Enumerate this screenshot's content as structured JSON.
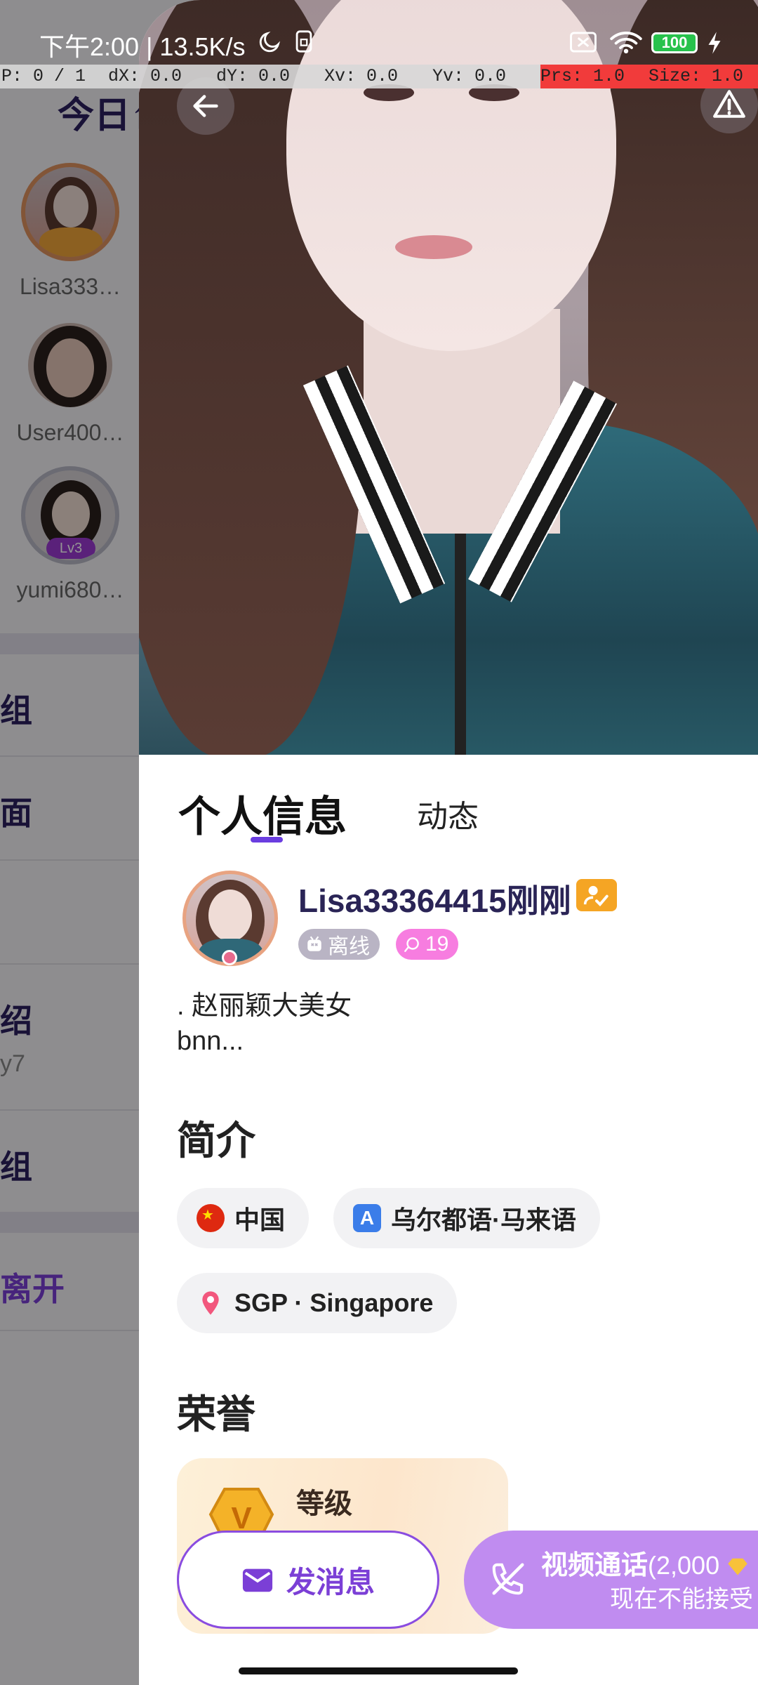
{
  "status_bar": {
    "text": "下午2:00 | 13.5K/s",
    "battery": "100"
  },
  "debug_bar": {
    "p": "P: 0 / 1",
    "dx": "dX: 0.0",
    "dy": "dY: 0.0",
    "xv": "Xv: 0.0",
    "yv": "Yv: 0.0",
    "prs": "Prs: 1.0",
    "size": "Size: 1.0"
  },
  "background_page": {
    "title": "今日↑",
    "users": [
      "Lisa333…",
      "User400…",
      "yumi680…"
    ],
    "level_badge": "Lv3",
    "rows": [
      {
        "label": "组",
        "sub": ""
      },
      {
        "label": "面",
        "sub": ""
      },
      {
        "label": "",
        "sub": ""
      },
      {
        "label": "绍",
        "sub": "y7"
      },
      {
        "label": "组",
        "sub": ""
      }
    ],
    "leave": "离开"
  },
  "profile": {
    "tabs": [
      "个人信息",
      "动态"
    ],
    "username": "Lisa33364415刚刚",
    "offline_label": "离线",
    "count_label": "19",
    "bio": ". 赵丽颖大美女\nbnn...",
    "intro_title": "简介",
    "chips": {
      "country": "中国",
      "languages": "乌尔都语·马来语",
      "location": "SGP · Singapore"
    },
    "honor_title": "荣誉",
    "honor_level_label": "等级"
  },
  "actions": {
    "send_message": "发消息",
    "video_call": "视频通话",
    "video_price": "(2,000",
    "video_status": "现在不能接受"
  },
  "colors": {
    "accent": "#7b3fd6",
    "video_button": "#c08cf0",
    "gold": "#f5a524"
  }
}
